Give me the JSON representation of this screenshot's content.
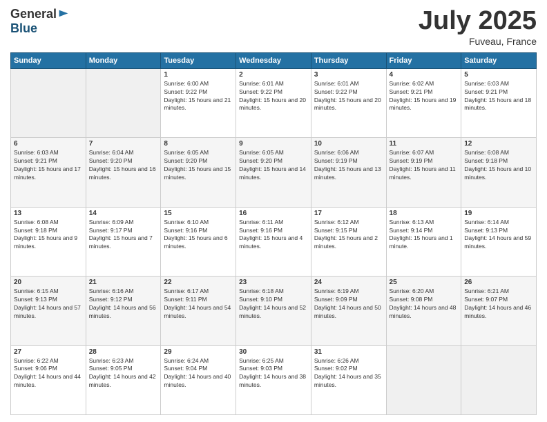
{
  "header": {
    "logo_general": "General",
    "logo_blue": "Blue",
    "month_title": "July 2025",
    "location": "Fuveau, France"
  },
  "weekdays": [
    "Sunday",
    "Monday",
    "Tuesday",
    "Wednesday",
    "Thursday",
    "Friday",
    "Saturday"
  ],
  "weeks": [
    [
      {
        "day": "",
        "info": ""
      },
      {
        "day": "",
        "info": ""
      },
      {
        "day": "1",
        "info": "Sunrise: 6:00 AM\nSunset: 9:22 PM\nDaylight: 15 hours and 21 minutes."
      },
      {
        "day": "2",
        "info": "Sunrise: 6:01 AM\nSunset: 9:22 PM\nDaylight: 15 hours and 20 minutes."
      },
      {
        "day": "3",
        "info": "Sunrise: 6:01 AM\nSunset: 9:22 PM\nDaylight: 15 hours and 20 minutes."
      },
      {
        "day": "4",
        "info": "Sunrise: 6:02 AM\nSunset: 9:21 PM\nDaylight: 15 hours and 19 minutes."
      },
      {
        "day": "5",
        "info": "Sunrise: 6:03 AM\nSunset: 9:21 PM\nDaylight: 15 hours and 18 minutes."
      }
    ],
    [
      {
        "day": "6",
        "info": "Sunrise: 6:03 AM\nSunset: 9:21 PM\nDaylight: 15 hours and 17 minutes."
      },
      {
        "day": "7",
        "info": "Sunrise: 6:04 AM\nSunset: 9:20 PM\nDaylight: 15 hours and 16 minutes."
      },
      {
        "day": "8",
        "info": "Sunrise: 6:05 AM\nSunset: 9:20 PM\nDaylight: 15 hours and 15 minutes."
      },
      {
        "day": "9",
        "info": "Sunrise: 6:05 AM\nSunset: 9:20 PM\nDaylight: 15 hours and 14 minutes."
      },
      {
        "day": "10",
        "info": "Sunrise: 6:06 AM\nSunset: 9:19 PM\nDaylight: 15 hours and 13 minutes."
      },
      {
        "day": "11",
        "info": "Sunrise: 6:07 AM\nSunset: 9:19 PM\nDaylight: 15 hours and 11 minutes."
      },
      {
        "day": "12",
        "info": "Sunrise: 6:08 AM\nSunset: 9:18 PM\nDaylight: 15 hours and 10 minutes."
      }
    ],
    [
      {
        "day": "13",
        "info": "Sunrise: 6:08 AM\nSunset: 9:18 PM\nDaylight: 15 hours and 9 minutes."
      },
      {
        "day": "14",
        "info": "Sunrise: 6:09 AM\nSunset: 9:17 PM\nDaylight: 15 hours and 7 minutes."
      },
      {
        "day": "15",
        "info": "Sunrise: 6:10 AM\nSunset: 9:16 PM\nDaylight: 15 hours and 6 minutes."
      },
      {
        "day": "16",
        "info": "Sunrise: 6:11 AM\nSunset: 9:16 PM\nDaylight: 15 hours and 4 minutes."
      },
      {
        "day": "17",
        "info": "Sunrise: 6:12 AM\nSunset: 9:15 PM\nDaylight: 15 hours and 2 minutes."
      },
      {
        "day": "18",
        "info": "Sunrise: 6:13 AM\nSunset: 9:14 PM\nDaylight: 15 hours and 1 minute."
      },
      {
        "day": "19",
        "info": "Sunrise: 6:14 AM\nSunset: 9:13 PM\nDaylight: 14 hours and 59 minutes."
      }
    ],
    [
      {
        "day": "20",
        "info": "Sunrise: 6:15 AM\nSunset: 9:13 PM\nDaylight: 14 hours and 57 minutes."
      },
      {
        "day": "21",
        "info": "Sunrise: 6:16 AM\nSunset: 9:12 PM\nDaylight: 14 hours and 56 minutes."
      },
      {
        "day": "22",
        "info": "Sunrise: 6:17 AM\nSunset: 9:11 PM\nDaylight: 14 hours and 54 minutes."
      },
      {
        "day": "23",
        "info": "Sunrise: 6:18 AM\nSunset: 9:10 PM\nDaylight: 14 hours and 52 minutes."
      },
      {
        "day": "24",
        "info": "Sunrise: 6:19 AM\nSunset: 9:09 PM\nDaylight: 14 hours and 50 minutes."
      },
      {
        "day": "25",
        "info": "Sunrise: 6:20 AM\nSunset: 9:08 PM\nDaylight: 14 hours and 48 minutes."
      },
      {
        "day": "26",
        "info": "Sunrise: 6:21 AM\nSunset: 9:07 PM\nDaylight: 14 hours and 46 minutes."
      }
    ],
    [
      {
        "day": "27",
        "info": "Sunrise: 6:22 AM\nSunset: 9:06 PM\nDaylight: 14 hours and 44 minutes."
      },
      {
        "day": "28",
        "info": "Sunrise: 6:23 AM\nSunset: 9:05 PM\nDaylight: 14 hours and 42 minutes."
      },
      {
        "day": "29",
        "info": "Sunrise: 6:24 AM\nSunset: 9:04 PM\nDaylight: 14 hours and 40 minutes."
      },
      {
        "day": "30",
        "info": "Sunrise: 6:25 AM\nSunset: 9:03 PM\nDaylight: 14 hours and 38 minutes."
      },
      {
        "day": "31",
        "info": "Sunrise: 6:26 AM\nSunset: 9:02 PM\nDaylight: 14 hours and 35 minutes."
      },
      {
        "day": "",
        "info": ""
      },
      {
        "day": "",
        "info": ""
      }
    ]
  ]
}
